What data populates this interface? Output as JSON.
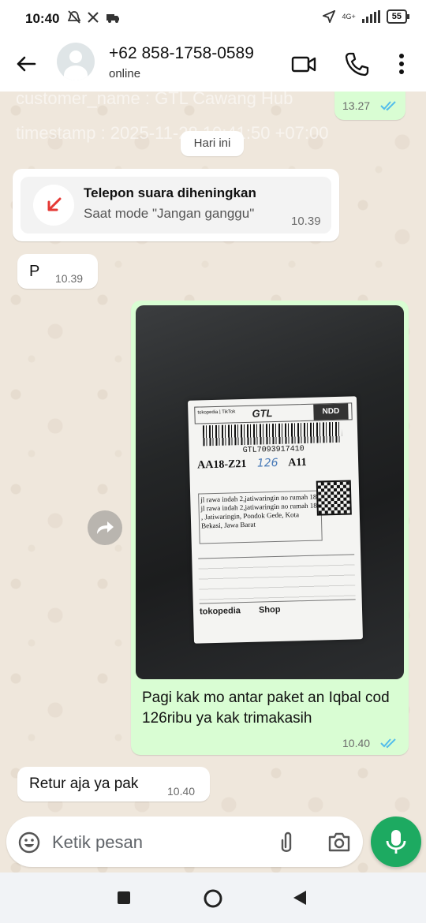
{
  "status_bar": {
    "time": "10:40",
    "network": "4G+",
    "battery": "55"
  },
  "header": {
    "contact_name": "+62 858-1758-0589",
    "status": "online"
  },
  "overlay": {
    "line1": "customer_name : GTL Cawang Hub",
    "line2": "timestamp : 2025-11-28 10:41:50 +07:00"
  },
  "chat": {
    "top_partial_time": "13.27",
    "date_divider": "Hari ini",
    "call_title": "Telepon suara diheningkan",
    "call_subtitle": "Saat mode \"Jangan ganggu\"",
    "call_time": "10.39",
    "msg1_text": "P",
    "msg1_time": "10.39",
    "image_caption": "Pagi kak mo antar paket an Iqbal cod 126ribu ya kak trimakasih",
    "image_time": "10.40",
    "msg3_text": "Retur aja ya pak",
    "msg3_time": "10.40"
  },
  "parcel_label": {
    "brand_left": "tokopedia | TikTok",
    "brand_center": "GTL",
    "service": "NDD",
    "tracking": "GTL7093917410",
    "sort_code": "AA18-Z21",
    "handwritten": "126",
    "area": "A11",
    "address": "jl rawa indah 2,jatiwaringin no rumah 18 jl rawa indah 2,jatiwaringin no rumah 18 , Jatiwaringin, Pondok Gede, Kota Bekasi, Jawa Barat",
    "footer_brand": "tokopedia",
    "footer_shop": "Shop"
  },
  "input": {
    "placeholder": "Ketik pesan"
  },
  "colors": {
    "outgoing_bubble": "#d9fdd3",
    "incoming_bubble": "#ffffff",
    "accent_green": "#1daa61",
    "read_ticks": "#53bdeb",
    "missed_call_red": "#e53935"
  },
  "icons": [
    "back-arrow-icon",
    "avatar-icon",
    "video-call-icon",
    "voice-call-icon",
    "more-options-icon",
    "missed-call-icon",
    "forward-icon",
    "emoji-icon",
    "attach-icon",
    "camera-icon",
    "mic-icon"
  ]
}
